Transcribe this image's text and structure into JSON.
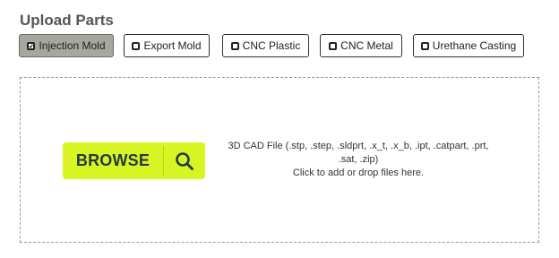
{
  "title": "Upload Parts",
  "process_options": [
    {
      "label": "Injection Mold",
      "checked": true
    },
    {
      "label": "Export Mold",
      "checked": false
    },
    {
      "label": "CNC Plastic",
      "checked": false
    },
    {
      "label": "CNC Metal",
      "checked": false
    },
    {
      "label": "Urethane Casting",
      "checked": false
    }
  ],
  "dropzone": {
    "browse_label": "BROWSE",
    "browse_icon": "search-icon",
    "formats_line1": "3D CAD File (.stp, .step, .sldprt, .x_t, .x_b, .ipt, .catpart, .prt,",
    "formats_line2": ".sat, .zip)",
    "instruction": "Click to add or drop files here."
  },
  "colors": {
    "browse_background": "#d6f522",
    "browse_text": "#243a45",
    "checked_option_background": "#a7a7a0",
    "title": "#555555"
  }
}
